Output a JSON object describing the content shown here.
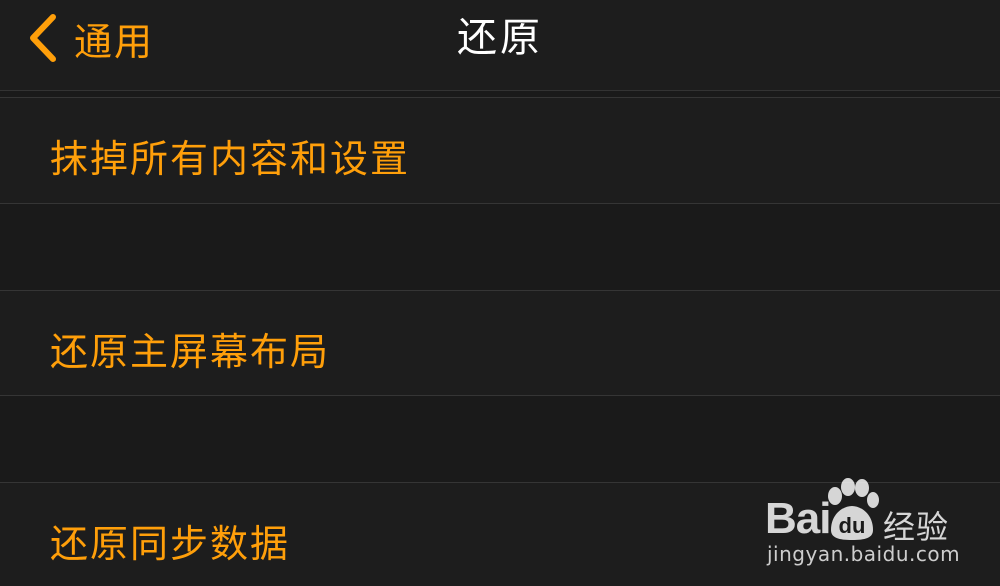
{
  "nav": {
    "back_label": "通用",
    "title": "还原"
  },
  "items": [
    {
      "label": "抹掉所有内容和设置"
    },
    {
      "label": "还原主屏幕布局"
    },
    {
      "label": "还原同步数据"
    }
  ],
  "watermark": {
    "brand_left": "Bai",
    "brand_paw": "du",
    "brand_suffix": "经验",
    "url": "jingyan.baidu.com"
  },
  "colors": {
    "accent": "#ff9f0a",
    "background": "#1b1b1b",
    "title": "#ffffff"
  },
  "icons": {
    "back": "chevron-left-icon"
  }
}
